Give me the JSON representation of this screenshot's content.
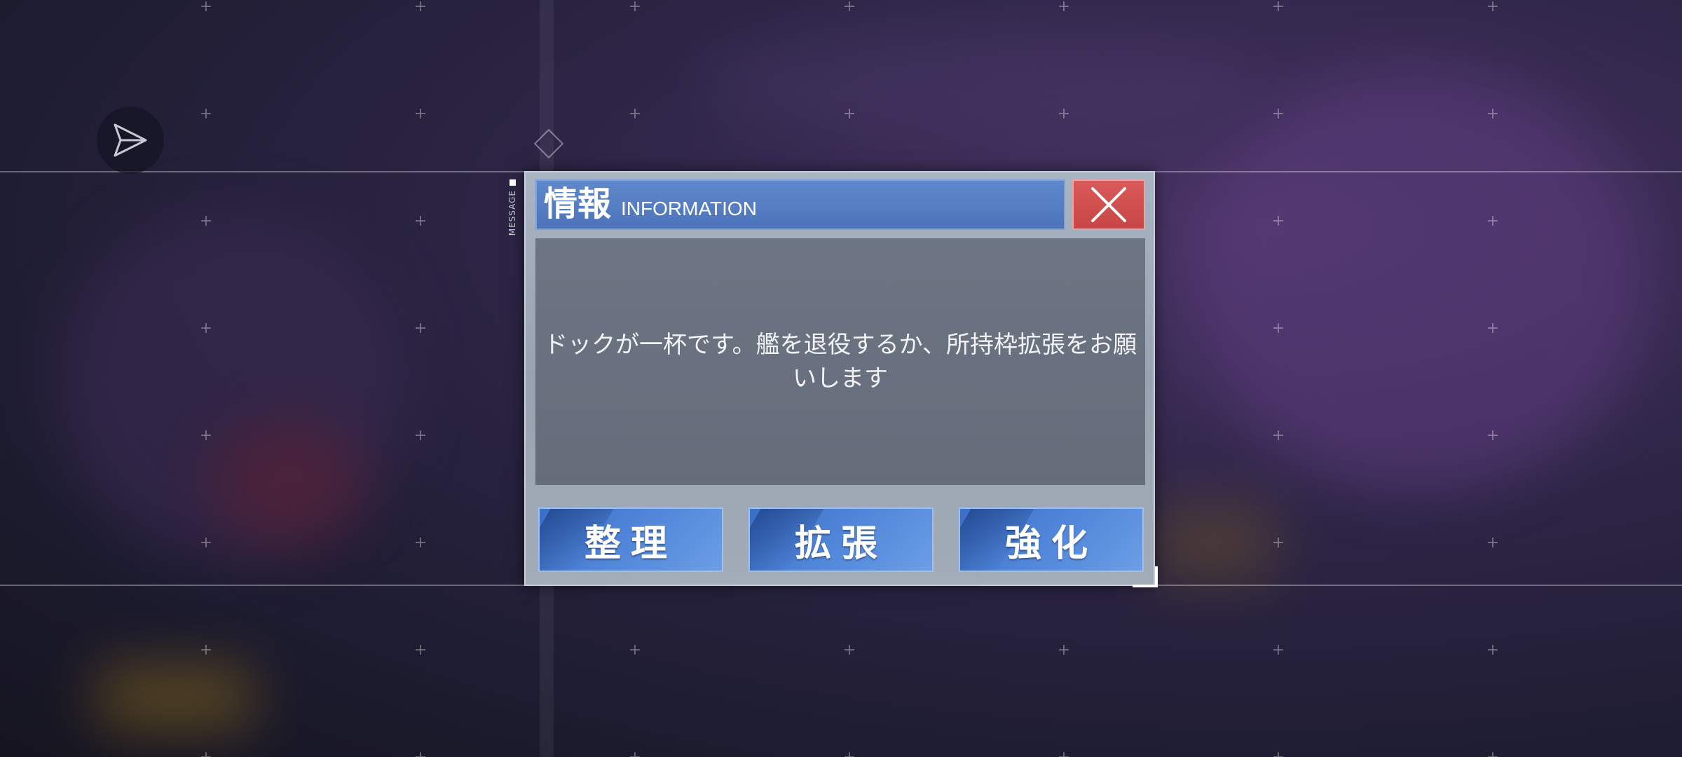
{
  "dialog": {
    "side_label": "MESSAGE",
    "title_jp": "情報",
    "title_en": "INFORMATION",
    "message": "ドックが一杯です。艦を退役するか、所持枠拡張をお願いします",
    "buttons": {
      "organize": "整理",
      "expand": "拡張",
      "enhance": "強化"
    },
    "close_icon": "close-icon"
  },
  "hud": {
    "send_icon": "send-icon"
  },
  "colors": {
    "title_bar": "#4d74ba",
    "close_button": "#c84646",
    "action_button": "#4f84d8",
    "message_panel": "#6a7281"
  }
}
